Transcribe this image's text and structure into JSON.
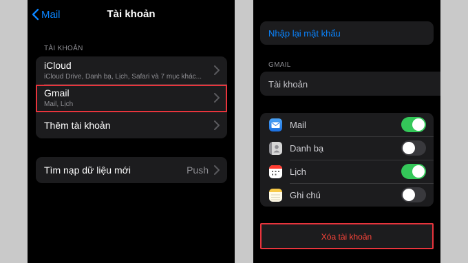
{
  "left": {
    "back_label": "Mail",
    "title": "Tài khoản",
    "section_label": "TÀI KHOẢN",
    "accounts": [
      {
        "title": "iCloud",
        "subtitle": "iCloud Drive, Danh bạ, Lịch, Safari và 7 mục khác..."
      },
      {
        "title": "Gmail",
        "subtitle": "Mail, Lịch"
      },
      {
        "title": "Thêm tài khoản",
        "subtitle": ""
      }
    ],
    "fetch": {
      "label": "Tìm nạp dữ liệu mới",
      "value": "Push"
    }
  },
  "right": {
    "reenter_password": "Nhập lại mật khẩu",
    "gmail_section_label": "GMAIL",
    "account_field": "Tài khoản",
    "services": [
      {
        "label": "Mail",
        "icon": "mail-app-icon",
        "enabled": true
      },
      {
        "label": "Danh bạ",
        "icon": "contacts-app-icon",
        "enabled": false
      },
      {
        "label": "Lịch",
        "icon": "calendar-app-icon",
        "enabled": true
      },
      {
        "label": "Ghi chú",
        "icon": "notes-app-icon",
        "enabled": false
      }
    ],
    "delete_account": "Xóa tài khoản"
  },
  "colors": {
    "accent_blue": "#0a84ff",
    "toggle_on": "#34c759",
    "destructive": "#ff453a",
    "highlight_border": "#e8343c"
  }
}
